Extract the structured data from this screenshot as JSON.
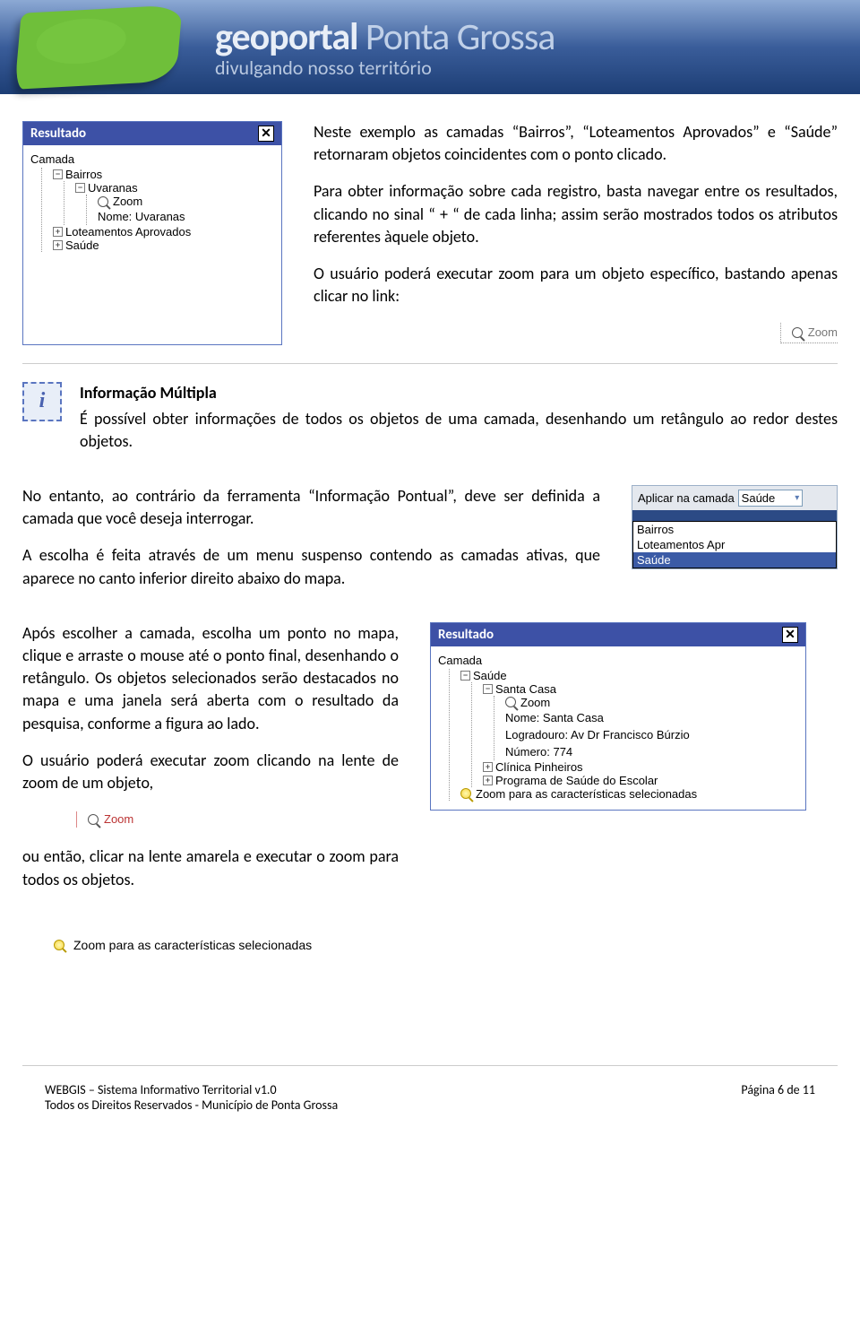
{
  "header": {
    "title_bold": "geoportal",
    "title_light": " Ponta Grossa",
    "subtitle": "divulgando nosso território"
  },
  "panel1": {
    "title": "Resultado",
    "root": "Camada",
    "n1": "Bairros",
    "n2": "Uvaranas",
    "n3_zoom": "Zoom",
    "n4": "Nome:  Uvaranas",
    "n5": "Loteamentos Aprovados",
    "n6": "Saúde"
  },
  "text1": {
    "p1": "Neste exemplo as camadas “Bairros”, “Loteamentos Aprovados” e “Saúde” retornaram objetos coincidentes com o ponto clicado.",
    "p2": "Para obter informação sobre cada registro, basta navegar entre os resultados, clicando no sinal “ + “ de cada linha; assim serão mostrados todos os atributos referentes àquele objeto.",
    "p3": "O usuário poderá executar zoom para um objeto específico, bastando apenas clicar no link:",
    "zoom_label": "Zoom"
  },
  "info_multi": {
    "title": "Informação Múltipla",
    "body": "É possível obter informações de todos os objetos de uma camada, desenhando um retângulo ao redor destes objetos."
  },
  "text2": {
    "p1": "No entanto, ao contrário da ferramenta “Informação Pontual”, deve ser definida a camada que você deseja interrogar.",
    "p2": "A escolha é feita através de um menu suspenso contendo as camadas ativas, que aparece no canto inferior direito abaixo do mapa."
  },
  "select": {
    "label": "Aplicar na camada",
    "value": "Saúde",
    "opt1": "Bairros",
    "opt2": "Loteamentos Apr",
    "opt3": "Saúde"
  },
  "text3": {
    "p1": "Após escolher a camada, escolha um ponto no mapa, clique e arraste o mouse até o ponto final, desenhando o retângulo. Os objetos selecionados serão destacados no mapa e uma janela será aberta com o resultado da pesquisa, conforme a figura ao lado.",
    "p2": "O usuário poderá executar zoom clicando na lente de zoom de um objeto,",
    "zoom_label": "Zoom",
    "p3": "ou então, clicar na lente amarela e executar o zoom para todos os objetos.",
    "zoom_all": "Zoom para as características selecionadas"
  },
  "panel2": {
    "title": "Resultado",
    "root": "Camada",
    "n1": "Saúde",
    "n2": "Santa Casa",
    "n3_zoom": "Zoom",
    "n4": "Nome:  Santa Casa",
    "n5": "Logradouro:  Av Dr Francisco Búrzio",
    "n6": "Número:  774",
    "n7": "Clínica Pinheiros",
    "n8": "Programa de Saúde do Escolar",
    "n9": "Zoom para as características selecionadas"
  },
  "footer": {
    "l1": "WEBGIS – Sistema Informativo Territorial v1.0",
    "l2": "Todos os Direitos Reservados - Município de Ponta Grossa",
    "page": "Página 6 de 11"
  }
}
